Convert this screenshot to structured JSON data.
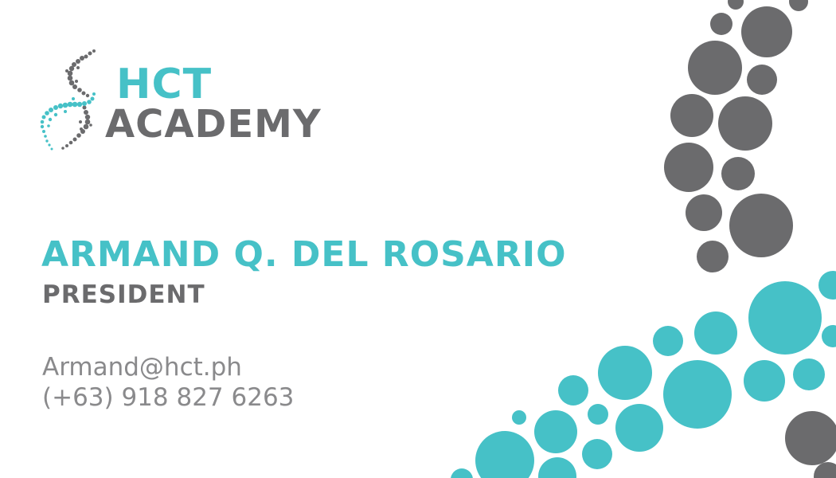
{
  "logo": {
    "line1": "HCT",
    "line2": "ACADEMY",
    "icon": "dna-helix-logo-icon"
  },
  "person": {
    "name": "ARMAND Q. DEL ROSARIO",
    "title": "PRESIDENT",
    "email": "Armand@hct.ph",
    "phone": "(+63) 918 827 6263"
  },
  "colors": {
    "teal": "#46c1c7",
    "gray": "#6b6b6d",
    "text_gray": "#8a8a8c",
    "background": "#ffffff"
  },
  "decoration": {
    "icon": "dot-pattern-decoration"
  }
}
